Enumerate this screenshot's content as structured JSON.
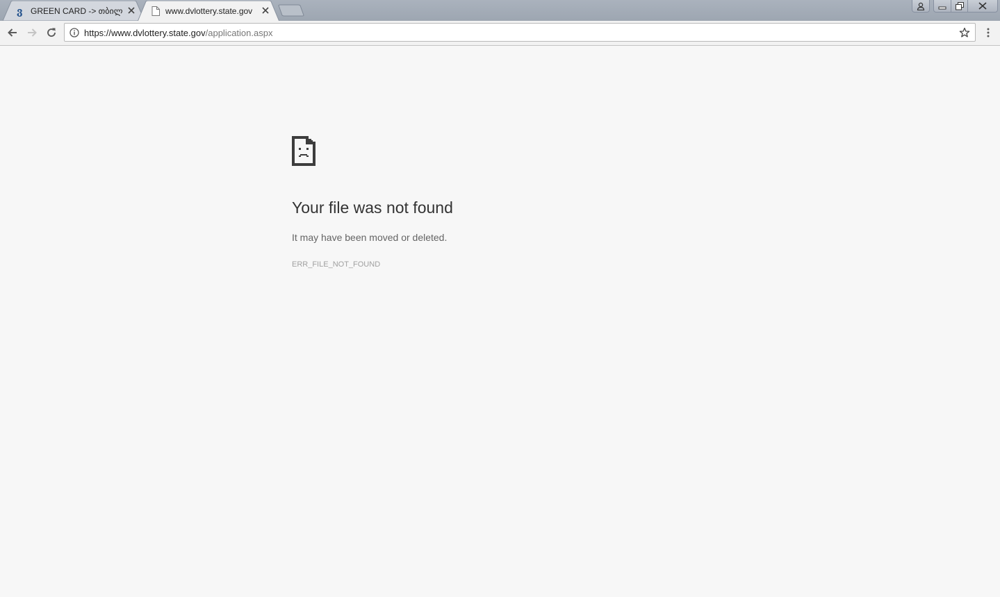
{
  "browser": {
    "tabs": [
      {
        "title": "GREEN CARD -> თბილი",
        "favicon": "georgian-letter-logo",
        "active": false
      },
      {
        "title": "www.dvlottery.state.gov",
        "favicon": "document-icon",
        "active": true
      }
    ],
    "address_bar": {
      "url_host": "https://www.dvlottery.state.gov",
      "url_path": "/application.aspx"
    }
  },
  "error_page": {
    "title": "Your file was not found",
    "description": "It may have been moved or deleted.",
    "code": "ERR_FILE_NOT_FOUND"
  },
  "colors": {
    "page_background": "#f7f7f7",
    "tabstrip": "#9da6b1",
    "favicon_blue": "#1f4f8b"
  }
}
